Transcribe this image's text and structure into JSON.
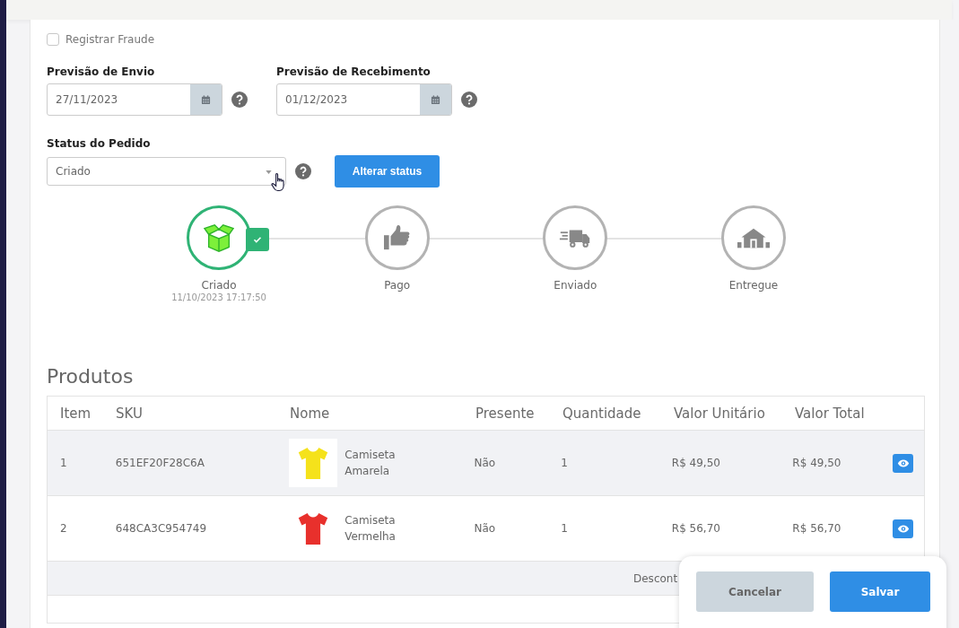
{
  "fraud_checkbox": {
    "label": "Registrar Fraude",
    "checked": false
  },
  "date_fields": [
    {
      "label": "Previsão de Envio",
      "value": "27/11/2023"
    },
    {
      "label": "Previsão de Recebimento",
      "value": "01/12/2023"
    }
  ],
  "status_field": {
    "label": "Status do Pedido",
    "value": "Criado"
  },
  "change_status_button": "Alterar status",
  "steps": [
    {
      "kind": "box",
      "label": "Criado",
      "date": "11/10/2023 17:17:50",
      "done": true
    },
    {
      "kind": "thumb",
      "label": "Pago",
      "done": false
    },
    {
      "kind": "truck",
      "label": "Enviado",
      "done": false
    },
    {
      "kind": "house",
      "label": "Entregue",
      "done": false
    }
  ],
  "products": {
    "title": "Produtos",
    "columns": [
      "Item",
      "SKU",
      "Nome",
      "Presente",
      "Quantidade",
      "Valor Unitário",
      "Valor Total"
    ],
    "rows": [
      {
        "item": "1",
        "sku": "651EF20F28C6A",
        "name": "Camiseta Amarela",
        "gift": "Não",
        "quantity": "1",
        "unit_price": "R$ 49,50",
        "total": "R$ 49,50",
        "color": "#f5e21b",
        "highlighted": true
      },
      {
        "item": "2",
        "sku": "648CA3C954749",
        "name": "Camiseta Vermelha",
        "gift": "Não",
        "quantity": "1",
        "unit_price": "R$ 56,70",
        "total": "R$ 56,70",
        "color": "#e8302c",
        "highlighted": false
      }
    ],
    "footer_label": "Descont"
  },
  "actions": [
    "Cancelar",
    "Salvar"
  ]
}
